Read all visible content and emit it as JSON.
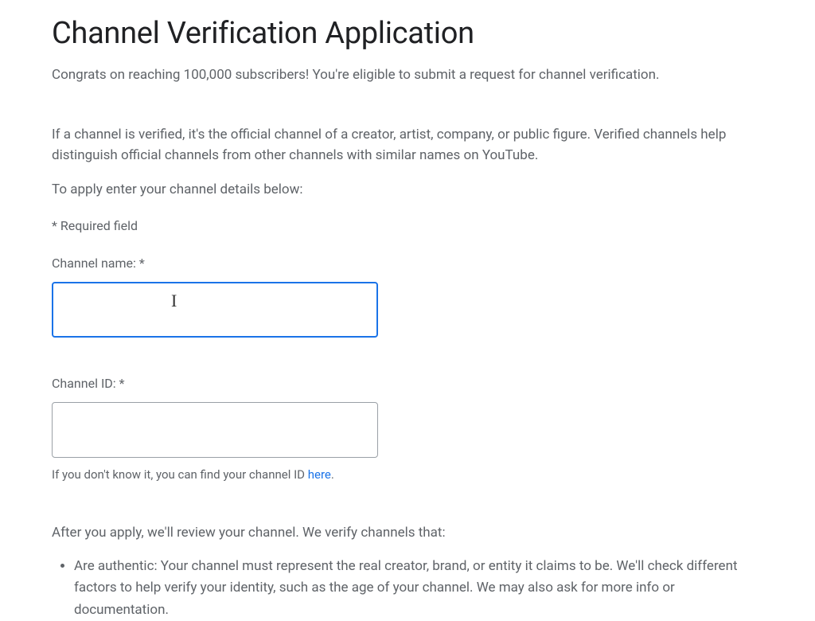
{
  "title": "Channel Verification Application",
  "subtitle": "Congrats on reaching 100,000 subscribers! You're eligible to submit a request for channel verification.",
  "description": "If a channel is verified, it's the official channel of a creator, artist, company, or public figure. Verified channels help distinguish official channels from other channels with similar names on YouTube.",
  "instruction": "To apply enter your channel details below:",
  "requiredNote": "* Required field",
  "fields": {
    "channelName": {
      "label": "Channel name: *",
      "value": ""
    },
    "channelId": {
      "label": "Channel ID: *",
      "value": "",
      "helperPrefix": "If you don't know it, you can find your channel ID ",
      "helperLinkText": "here",
      "helperSuffix": "."
    }
  },
  "review": {
    "heading": "After you apply, we'll review your channel. We verify channels that:",
    "criteria": [
      "Are authentic: Your channel must represent the real creator, brand, or entity it claims to be. We'll check different factors to help verify your identity, such as the age of your channel. We may also ask for more info or documentation."
    ]
  }
}
